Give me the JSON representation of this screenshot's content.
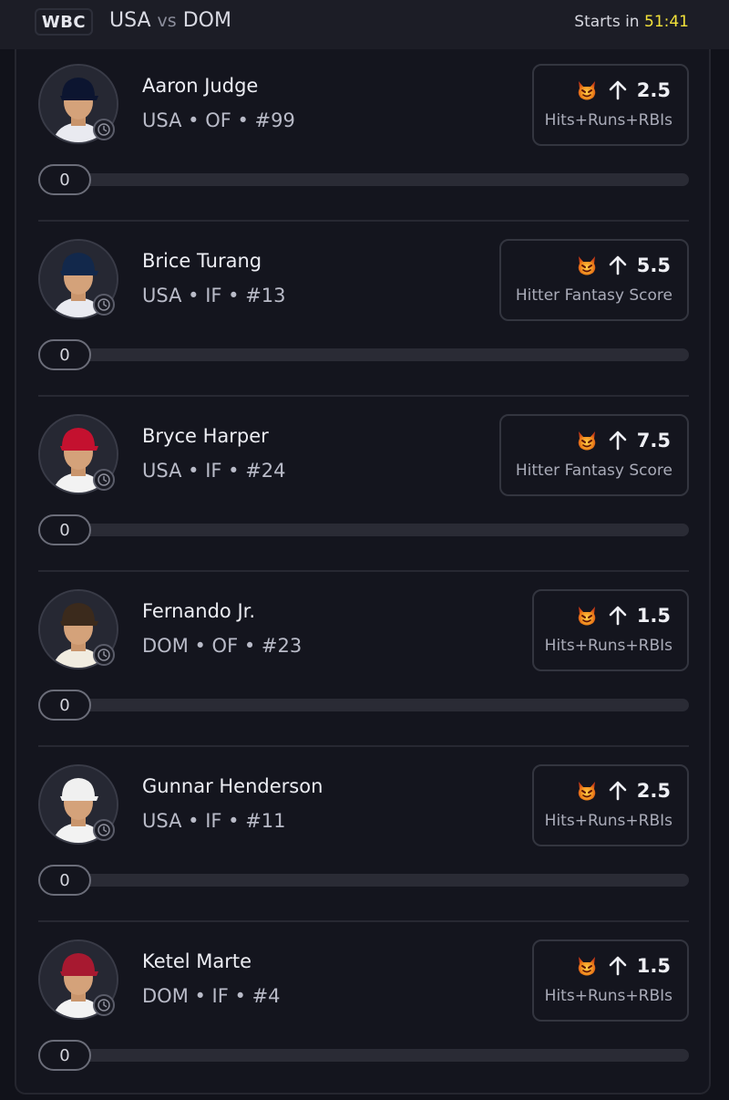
{
  "header": {
    "league": "WBC",
    "team_home": "USA",
    "vs": "vs",
    "team_away": "DOM",
    "starts_label": "Starts in",
    "countdown": "51:41"
  },
  "colors": {
    "countdown": "#f3e23a",
    "background": "#11121a",
    "card_border": "#33353f"
  },
  "players": [
    {
      "name": "Aaron Judge",
      "meta": "USA • OF • #99",
      "line": "2.5",
      "stat": "Hits+Runs+RBIs",
      "progress": "0",
      "direction_icon": "arrow-up-icon",
      "badge_icon": "demon-icon",
      "cap_color": "#0c1530",
      "jersey_color": "#e9eaf0"
    },
    {
      "name": "Brice Turang",
      "meta": "USA • IF • #13",
      "line": "5.5",
      "stat": "Hitter Fantasy Score",
      "progress": "0",
      "direction_icon": "arrow-up-icon",
      "badge_icon": "demon-icon",
      "cap_color": "#12284b",
      "jersey_color": "#e9eaf0"
    },
    {
      "name": "Bryce Harper",
      "meta": "USA • IF • #24",
      "line": "7.5",
      "stat": "Hitter Fantasy Score",
      "progress": "0",
      "direction_icon": "arrow-up-icon",
      "badge_icon": "demon-icon",
      "cap_color": "#c4112f",
      "jersey_color": "#f2f2f2"
    },
    {
      "name": "Fernando Jr.",
      "meta": "DOM • OF • #23",
      "line": "1.5",
      "stat": "Hits+Runs+RBIs",
      "progress": "0",
      "direction_icon": "arrow-up-icon",
      "badge_icon": "demon-icon",
      "cap_color": "#3b2a1c",
      "jersey_color": "#f1ece0"
    },
    {
      "name": "Gunnar Henderson",
      "meta": "USA • IF • #11",
      "line": "2.5",
      "stat": "Hits+Runs+RBIs",
      "progress": "0",
      "direction_icon": "arrow-up-icon",
      "badge_icon": "demon-icon",
      "cap_color": "#f0f0f0",
      "jersey_color": "#f2f2f2"
    },
    {
      "name": "Ketel Marte",
      "meta": "DOM • IF • #4",
      "line": "1.5",
      "stat": "Hits+Runs+RBIs",
      "progress": "0",
      "direction_icon": "arrow-up-icon",
      "badge_icon": "demon-icon",
      "cap_color": "#a71930",
      "jersey_color": "#f2f2f2"
    }
  ]
}
